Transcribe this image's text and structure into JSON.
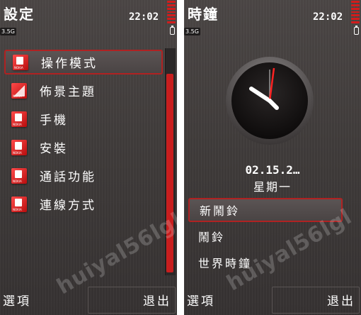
{
  "settings_screen": {
    "title": "設定",
    "time": "22:02",
    "network": "3.5G",
    "menu": [
      {
        "label": "操作模式",
        "icon": "profiles-icon"
      },
      {
        "label": "佈景主題",
        "icon": "themes-icon"
      },
      {
        "label": "手機",
        "icon": "phone-icon"
      },
      {
        "label": "安裝",
        "icon": "install-icon"
      },
      {
        "label": "通話功能",
        "icon": "call-icon"
      },
      {
        "label": "連線方式",
        "icon": "connectivity-icon"
      }
    ],
    "softkeys": {
      "left": "選項",
      "right": "退出"
    },
    "watermark": "huiyal56lgl"
  },
  "clock_screen": {
    "title": "時鐘",
    "time": "22:02",
    "network": "3.5G",
    "date": "02.15.2…",
    "weekday": "星期一",
    "menu": [
      {
        "label": "新鬧鈴"
      },
      {
        "label": "鬧鈴"
      },
      {
        "label": "世界時鐘"
      }
    ],
    "softkeys": {
      "left": "選項",
      "right": "退出"
    },
    "watermark": "huiyal56lgl"
  },
  "colors": {
    "accent": "#c81e1e",
    "background": "#3e3a39",
    "text": "#ffffff"
  }
}
